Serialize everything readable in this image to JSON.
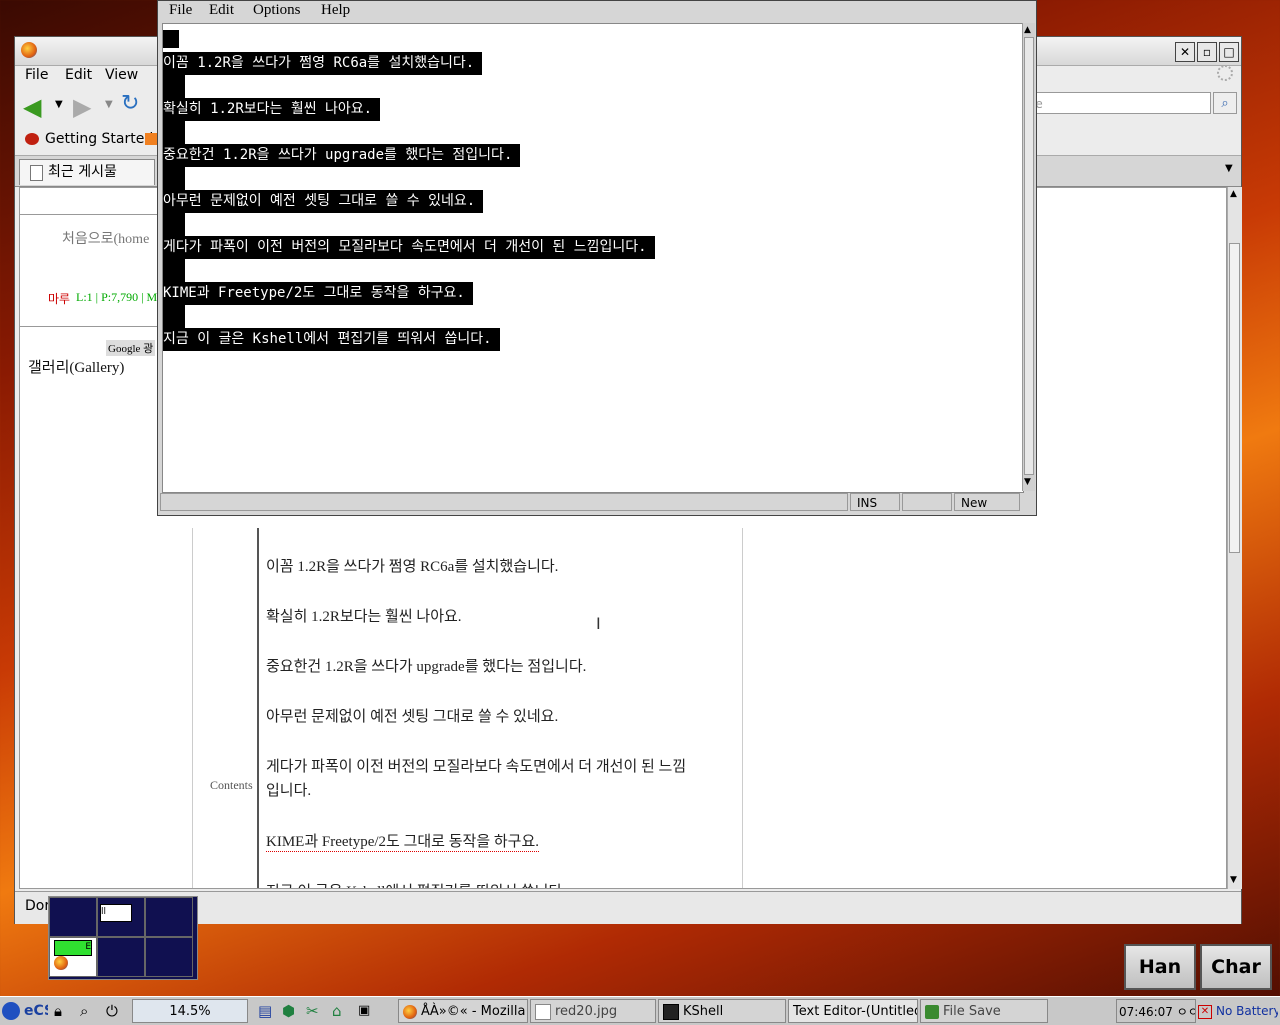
{
  "browser": {
    "menu": [
      "File",
      "Edit",
      "View"
    ],
    "bookmarks": {
      "getting_started": "Getting Started"
    },
    "tab_label": "최근 게시물",
    "search_placeholder": "le",
    "sidebar": {
      "home_link": "처음으로(home",
      "maru_label": "마루",
      "maru_stats": "L:1 | P:7,790 | M",
      "google_label": "Google 광",
      "gallery": "갤러리(Gallery)",
      "contents_label": "Contents"
    },
    "post_lines": [
      "이꼼 1.2R을 쓰다가 쩜영 RC6a를 설치했습니다.",
      "확실히 1.2R보다는 훨씬 나아요.",
      "중요한건 1.2R을 쓰다가 upgrade를 했다는 점입니다.",
      "아무런 문제없이 예전 셋팅 그대로 쓸 수 있네요.",
      "게다가 파폭이 이전 버전의 모질라보다 속도면에서 더 개선이 된 느낌",
      "입니다.",
      "KIME과 Freetype/2도 그대로 동작을 하구요.",
      "지금 이 글은 Kshell에서 편집기를 띄워서 씁니다."
    ],
    "status": "Dor"
  },
  "editor": {
    "menu": [
      "File",
      "Edit",
      "Options",
      "Help"
    ],
    "lines": [
      "이꼼 1.2R을 쓰다가 쩜영 RC6a를 설치했습니다.",
      "확실히 1.2R보다는 훨씬 나아요.",
      "중요한건 1.2R을 쓰다가 upgrade를 했다는 점입니다.",
      "아무런 문제없이 예전 셋팅 그대로 쓸 수 있네요.",
      "게다가 파폭이 이전 버전의 모질라보다 속도면에서 더 개선이 된 느낌입니다.",
      "KIME과 Freetype/2도 그대로 동작을 하구요.",
      "지금 이 글은 Kshell에서 편집기를 띄워서 씁니다."
    ],
    "status": {
      "mode": "INS",
      "state": "New"
    }
  },
  "ime": {
    "han": "Han",
    "char": "Char"
  },
  "taskbar": {
    "cpu": "14.5%",
    "tasks": [
      "ÅÀ»©« - Mozilla",
      "red20.jpg",
      "KShell",
      "Text Editor-(Untitled)",
      "File Save"
    ],
    "clock": "07:46:07 ㅇㅇ",
    "battery": "No Battery"
  },
  "pager": {
    "label_a": "ll",
    "label_b": "E"
  },
  "colors": {
    "highlight": "#000000",
    "highlight_text": "#ffffff",
    "link_green": "#00aa00"
  }
}
